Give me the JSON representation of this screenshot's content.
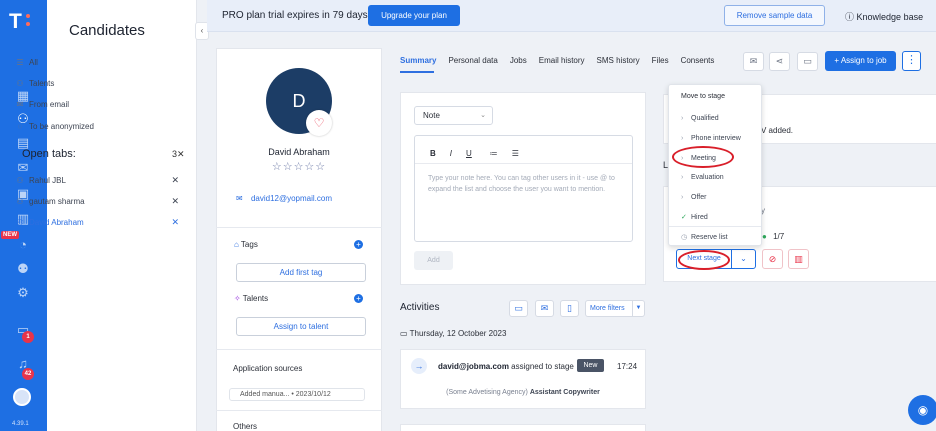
{
  "colors": {
    "brand": "#1e6fe3",
    "accent_red": "#e8344a",
    "annotation_red": "#d91f2a",
    "success_green": "#2fa85c"
  },
  "rail": {
    "logo": "T",
    "new_badge": "NEW",
    "inbox_count": "1",
    "notifications_count": "42",
    "version": "4.39.1",
    "icons": [
      "dashboard-icon",
      "candidates-icon",
      "jobs-icon",
      "messages-icon",
      "calendar-icon",
      "reports-icon",
      "analytics-icon",
      "team-icon",
      "settings-icon",
      "inbox-icon",
      "bell-icon"
    ]
  },
  "candidates_panel": {
    "title": "Candidates",
    "items": [
      {
        "label": "All",
        "icon": "list-icon"
      },
      {
        "label": "Talents",
        "icon": "talents-icon"
      },
      {
        "label": "From email",
        "icon": "email-icon"
      },
      {
        "label": "To be anonymized",
        "icon": "anonymize-icon"
      }
    ],
    "open_tabs_label": "Open tabs:",
    "open_tabs_count": "3",
    "open_tabs": [
      {
        "name": "Rahul JBL",
        "active": false
      },
      {
        "name": "gautam sharma",
        "active": false
      },
      {
        "name": "David Abraham",
        "active": true
      }
    ]
  },
  "topbar": {
    "trial_text": "PRO plan trial expires in 79 days",
    "upgrade_label": "Upgrade your plan",
    "remove_sample_label": "Remove sample data",
    "knowledge_base_label": "Knowledge base"
  },
  "profile": {
    "initial": "D",
    "name": "David Abraham",
    "stars": "☆☆☆☆☆",
    "email": "david12@yopmail.com",
    "tags_label": "Tags",
    "add_tag_label": "Add first tag",
    "talents_label": "Talents",
    "assign_talent_label": "Assign to talent",
    "app_sources_label": "Application sources",
    "app_source_chip": "Added manua... • 2023/10/12",
    "others_label": "Others"
  },
  "main_tabs": [
    "Summary",
    "Personal data",
    "Jobs",
    "Email history",
    "SMS history",
    "Files",
    "Consents"
  ],
  "actions": {
    "assign_job_label": "+ Assign to job",
    "more_label": "⋮"
  },
  "note": {
    "select_value": "Note",
    "toolbar": [
      "B",
      "I",
      "U",
      "≔",
      "☰"
    ],
    "placeholder": "Type your note here. You can tag other users in it - use @ to expand the list and choose the user you want to mention.",
    "add_label": "Add"
  },
  "activities": {
    "title": "Activities",
    "more_filters_label": "More filters",
    "date": "Thursday, 12 October 2023",
    "entry": {
      "user": "david@jobma.com",
      "action": "assigned to stage",
      "tag": "New",
      "time": "17:24",
      "agency": "(Some Advetising Agency)",
      "job": "Assistant Copywriter"
    }
  },
  "right": {
    "cv_added_fragment": "V added.",
    "l_fragment": "L",
    "y_fragment": "y",
    "fraction": "1/7",
    "next_stage_label": "Next stage"
  },
  "stage_dropdown": {
    "title": "Move to stage",
    "items": [
      {
        "label": "Qualified",
        "marker": "›"
      },
      {
        "label": "Phone interview",
        "marker": "›"
      },
      {
        "label": "Meeting",
        "marker": "›"
      },
      {
        "label": "Evaluation",
        "marker": "›"
      },
      {
        "label": "Offer",
        "marker": "›"
      },
      {
        "label": "Hired",
        "marker": "✓"
      },
      {
        "label": "Reserve list",
        "marker": "◷"
      }
    ]
  }
}
